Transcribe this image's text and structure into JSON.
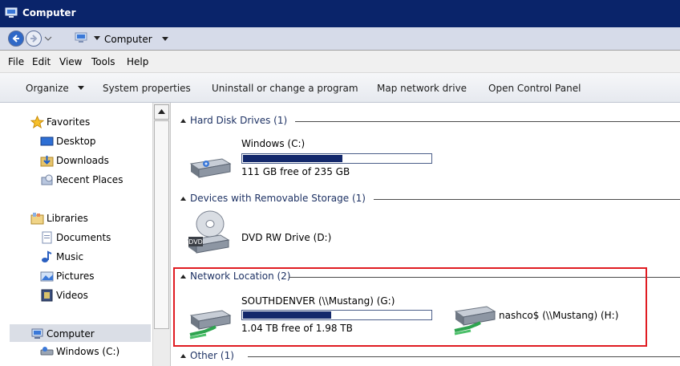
{
  "window": {
    "title": "Computer"
  },
  "address": {
    "location": "Computer"
  },
  "menu": [
    "File",
    "Edit",
    "View",
    "Tools",
    "Help"
  ],
  "toolbar": {
    "organize": "Organize",
    "system_properties": "System properties",
    "uninstall": "Uninstall or change a program",
    "map_drive": "Map network drive",
    "control_panel": "Open Control Panel"
  },
  "nav": {
    "favorites": "Favorites",
    "desktop": "Desktop",
    "downloads": "Downloads",
    "recent": "Recent Places",
    "libraries": "Libraries",
    "documents": "Documents",
    "music": "Music",
    "pictures": "Pictures",
    "videos": "Videos",
    "computer": "Computer",
    "windows_c": "Windows (C:)"
  },
  "groups": {
    "hdd": "Hard Disk Drives (1)",
    "removable": "Devices with Removable Storage (1)",
    "network": "Network Location (2)",
    "other": "Other (1)"
  },
  "drives": {
    "c": {
      "name": "Windows (C:)",
      "free": "111 GB free of 235 GB",
      "used_fraction": 0.53
    },
    "d": {
      "name": "DVD RW Drive (D:)"
    },
    "g": {
      "name": "SOUTHDENVER (\\\\Mustang) (G:)",
      "free": "1.04 TB free of 1.98 TB",
      "used_fraction": 0.47
    },
    "h": {
      "name": "nashco$ (\\\\Mustang) (H:)"
    }
  },
  "colors": {
    "title_bar": "#0a246a",
    "usage_fill": "#13286b",
    "highlight_box": "#e01c22"
  }
}
